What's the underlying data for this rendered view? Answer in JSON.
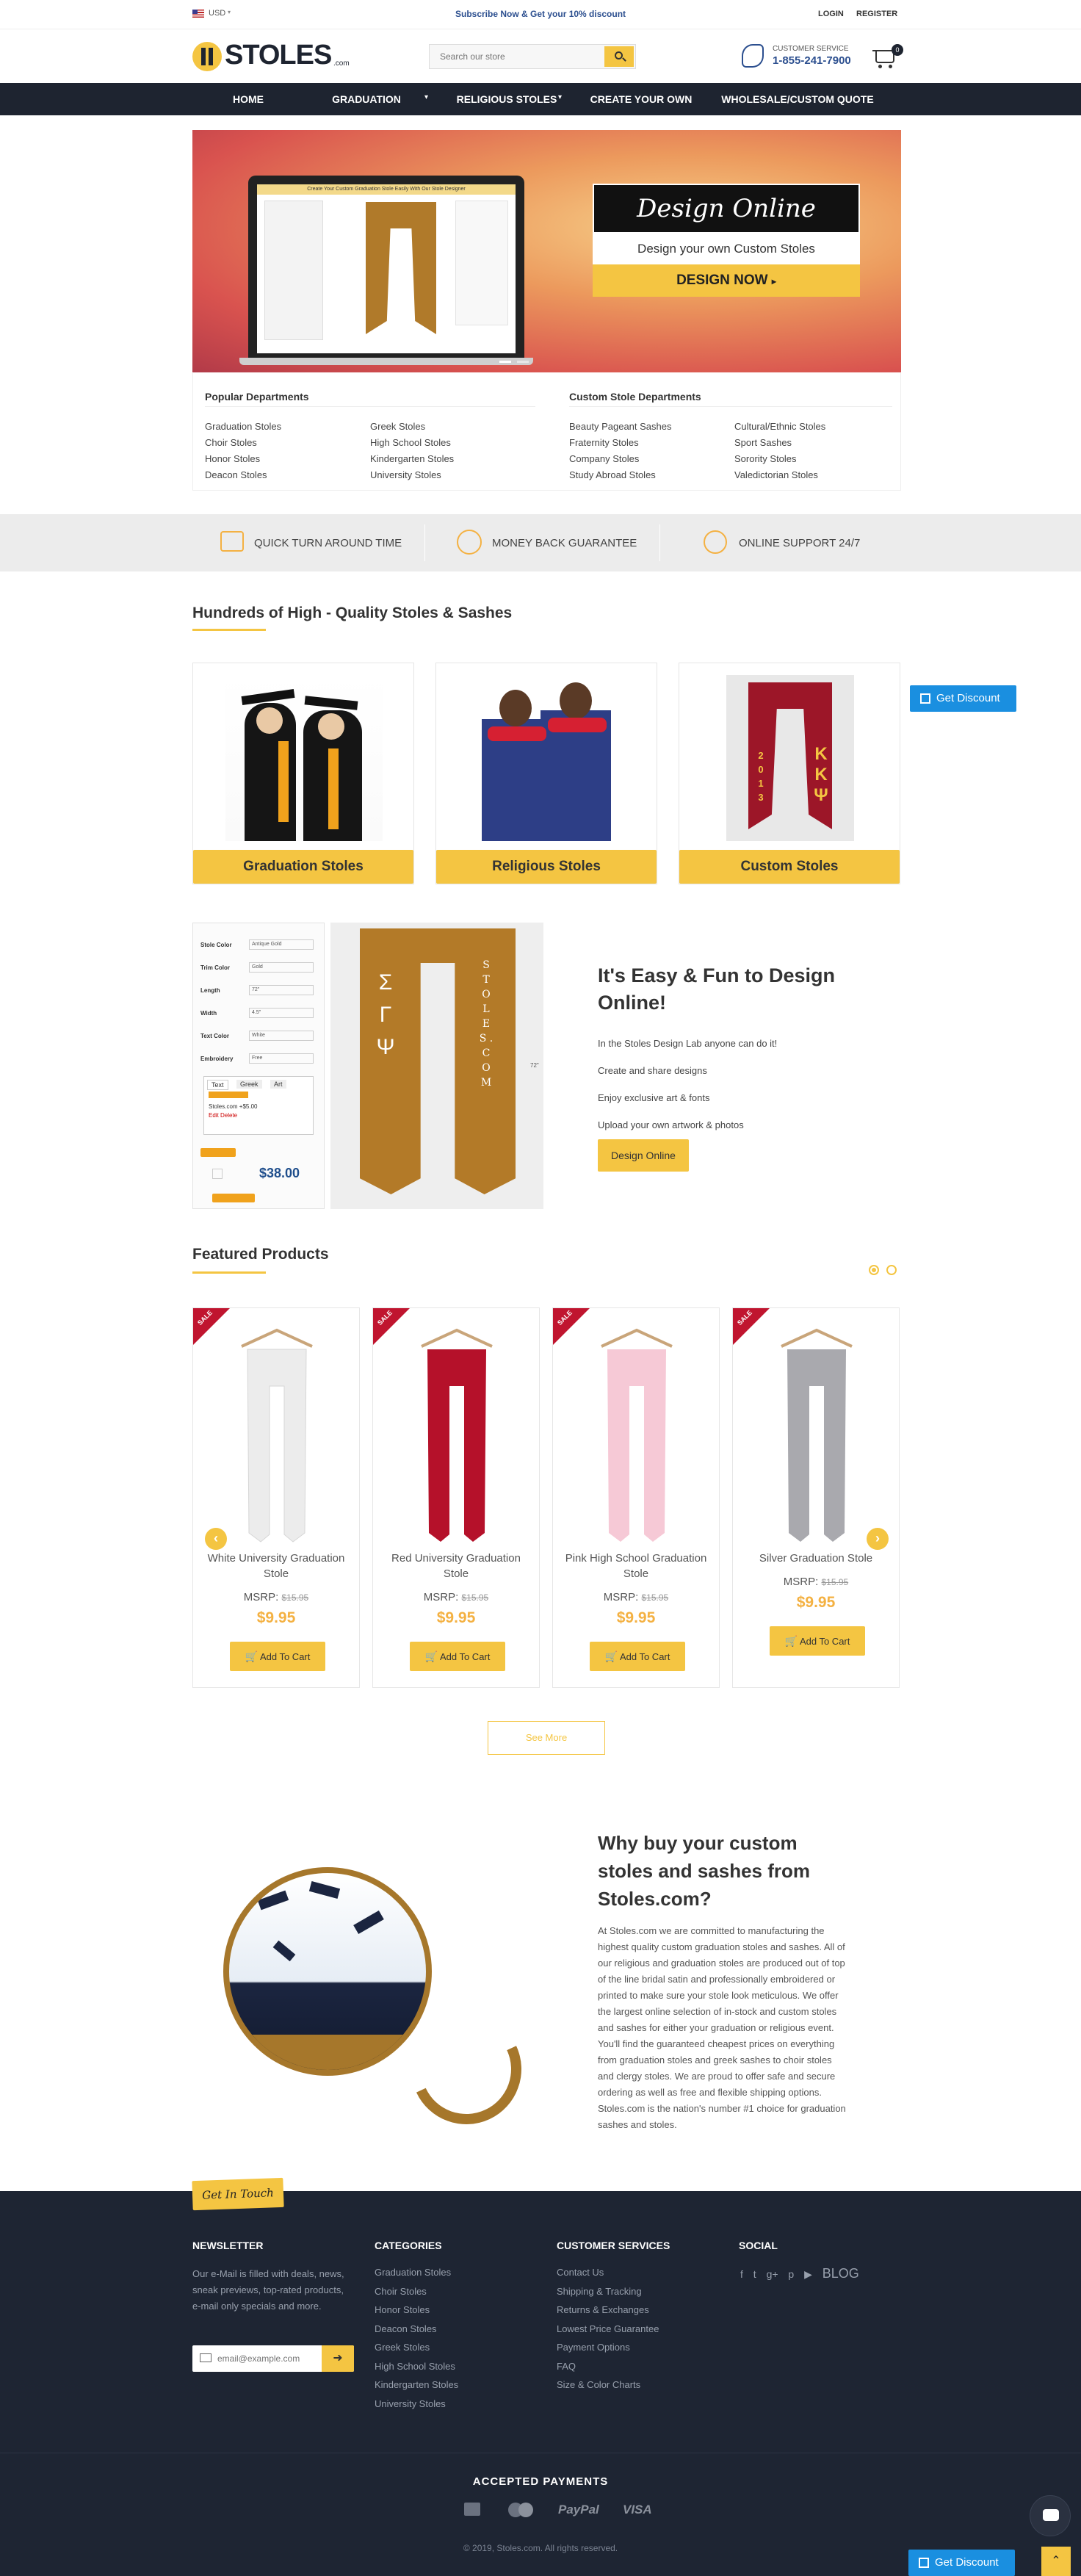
{
  "topbar": {
    "currency": "USD",
    "promo": "Subscribe Now & Get your 10% discount",
    "login": "LOGIN",
    "register": "REGISTER"
  },
  "header": {
    "logo_main": "STOLES",
    "logo_suffix": ".com",
    "search_placeholder": "Search our store",
    "cs_label": "CUSTOMER SERVICE",
    "cs_phone": "1-855-241-7900",
    "cart_count": "0"
  },
  "nav": {
    "items": [
      "HOME",
      "GRADUATION STOLES",
      "RELIGIOUS STOLES",
      "CREATE YOUR OWN",
      "WHOLESALE/CUSTOM QUOTE"
    ]
  },
  "hero": {
    "title": "Design Online",
    "subtitle": "Design your own Custom Stoles",
    "cta": "DESIGN NOW",
    "laptop_caption": "Create Your Custom Graduation Stole Easily With Our Stole Designer"
  },
  "departments": {
    "popular_title": "Popular Departments",
    "popular_col1": [
      "Graduation Stoles",
      "Choir Stoles",
      "Honor Stoles",
      "Deacon Stoles"
    ],
    "popular_col2": [
      "Greek Stoles",
      "High School Stoles",
      "Kindergarten Stoles",
      "University Stoles"
    ],
    "custom_title": "Custom Stole Departments",
    "custom_col1": [
      "Beauty Pageant Sashes",
      "Fraternity Stoles",
      "Company Stoles",
      "Study Abroad Stoles"
    ],
    "custom_col2": [
      "Cultural/Ethnic Stoles",
      "Sport Sashes",
      "Sorority Stoles",
      "Valedictorian Stoles"
    ]
  },
  "features": [
    "QUICK TURN AROUND TIME",
    "MONEY BACK GUARANTEE",
    "ONLINE SUPPORT 24/7"
  ],
  "categories": {
    "heading": "Hundreds of High - Quality Stoles & Sashes",
    "items": [
      "Graduation Stoles",
      "Religious Stoles",
      "Custom Stoles"
    ],
    "custom_stole_text": "2013"
  },
  "get_discount": "Get Discount",
  "design": {
    "title": "It's Easy & Fun to Design Online!",
    "lines": [
      "In the Stoles Design Lab anyone can do it!",
      "Create and share designs",
      "Enjoy exclusive art & fonts",
      "Upload your own artwork & photos"
    ],
    "button": "Design Online",
    "panel_labels": [
      "Stole Color",
      "Trim Color",
      "Length",
      "Width",
      "Text Color",
      "Embroidery"
    ],
    "panel_values": [
      "Antique Gold",
      "Gold",
      "72\"",
      "4.5\"",
      "White",
      "Free"
    ],
    "tabs": [
      "Text",
      "Greek",
      "Art"
    ],
    "panel_note": "Stoles.com +$5.00",
    "panel_links": "Edit  Delete",
    "price": "$38.00",
    "stole_left_text": "Σ Γ Ψ",
    "stole_right_text": "S T O L E S . C O M",
    "measure": "72\""
  },
  "featured": {
    "heading": "Featured Products",
    "sale": "SALE",
    "msrp_label": "MSRP:",
    "cart_label": "Add To Cart",
    "see_more": "See More",
    "products": [
      {
        "name": "White University Graduation Stole",
        "msrp": "$15.95",
        "price": "$9.95",
        "color": "#ececec"
      },
      {
        "name": "Red University Graduation Stole",
        "msrp": "$15.95",
        "price": "$9.95",
        "color": "#b5112a"
      },
      {
        "name": "Pink High School Graduation Stole",
        "msrp": "$15.95",
        "price": "$9.95",
        "color": "#f6c9d6"
      },
      {
        "name": "Silver Graduation Stole",
        "msrp": "$15.95",
        "price": "$9.95",
        "color": "#a9a9ae"
      }
    ]
  },
  "why": {
    "title": "Why buy your custom stoles and sashes from Stoles.com?",
    "body": "At Stoles.com we are committed to manufacturing the highest quality custom graduation stoles and sashes. All of our religious and graduation stoles are produced out of top of the line bridal satin and professionally embroidered or printed to make sure your stole look meticulous. We offer the largest online selection of in-stock and custom stoles and sashes for either your graduation or religious event. You'll find the guaranteed cheapest prices on everything from graduation stoles and greek sashes to choir stoles and clergy stoles. We are proud to offer safe and secure ordering as well as free and flexible shipping options. Stoles.com is the nation's number #1 choice for graduation sashes and stoles."
  },
  "footer": {
    "tag": "Get In Touch",
    "newsletter_title": "NEWSLETTER",
    "newsletter_text": "Our e-Mail is filled with deals, news, sneak previews, top-rated products, e-mail only specials and more.",
    "email_placeholder": "email@example.com",
    "categories_title": "CATEGORIES",
    "categories": [
      "Graduation Stoles",
      "Choir Stoles",
      "Honor Stoles",
      "Deacon Stoles",
      "Greek Stoles",
      "High School Stoles",
      "Kindergarten Stoles",
      "University Stoles"
    ],
    "cs_title": "CUSTOMER SERVICES",
    "cs_links": [
      "Contact Us",
      "Shipping & Tracking",
      "Returns & Exchanges",
      "Lowest Price Guarantee",
      "Payment Options",
      "FAQ",
      "Size & Color Charts"
    ],
    "social_title": "SOCIAL",
    "blog": "BLOG",
    "payments_title": "ACCEPTED PAYMENTS",
    "payments": [
      "PayPal",
      "VISA"
    ],
    "copyright": "© 2019, Stoles.com. All rights reserved."
  }
}
